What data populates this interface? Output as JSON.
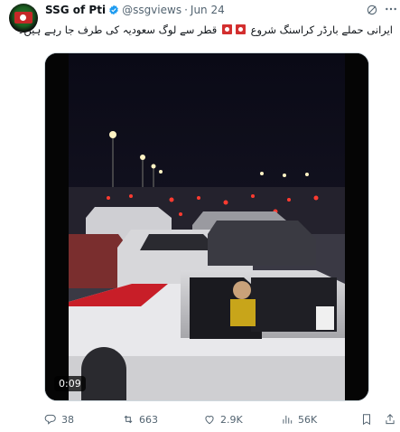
{
  "post": {
    "display_name": "SSG of Pti",
    "handle": "@ssgviews",
    "separator": "·",
    "date": "Jun 24",
    "text_part1": "ایرانی حملے بارڈر کراسنگ شروع",
    "text_part2": "قطر سے لوگ سعودیہ کی طرف جا رہے ہیں۔"
  },
  "video": {
    "duration": "0:09"
  },
  "actions": {
    "replies": "38",
    "reposts": "663",
    "likes": "2.9K",
    "views": "56K"
  },
  "icons": [
    "verified-icon",
    "grok-icon",
    "more-icon",
    "reply-icon",
    "repost-icon",
    "like-icon",
    "views-icon",
    "bookmark-icon",
    "share-icon"
  ],
  "colors": {
    "verified": "#1d9bf0",
    "muted": "#536471",
    "flag_red": "#d32f2f"
  }
}
